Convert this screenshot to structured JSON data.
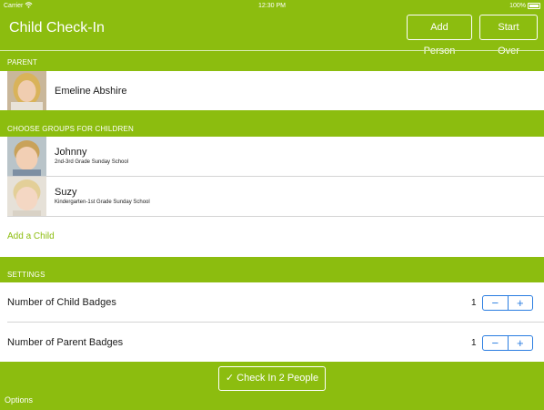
{
  "status_bar": {
    "carrier": "Carrier",
    "time": "12:30 PM",
    "battery": "100%"
  },
  "nav": {
    "title": "Child Check-In",
    "add_person_label": "Add Person",
    "start_over_label": "Start Over"
  },
  "parent_section": {
    "header": "PARENT",
    "name": "Emeline Abshire"
  },
  "children_section": {
    "header": "CHOOSE GROUPS FOR CHILDREN",
    "children": [
      {
        "name": "Johnny",
        "group": "2nd-3rd Grade Sunday School"
      },
      {
        "name": "Suzy",
        "group": "Kindergarten-1st Grade Sunday School"
      }
    ],
    "add_child_label": "Add a Child"
  },
  "settings_section": {
    "header": "SETTINGS",
    "rows": [
      {
        "label": "Number of Child Badges",
        "value": "1"
      },
      {
        "label": "Number of Parent Badges",
        "value": "1"
      }
    ],
    "minus_symbol": "−",
    "plus_symbol": "+"
  },
  "footer": {
    "check_in_label": "✓ Check In 2 People",
    "options_label": "Options"
  },
  "colors": {
    "brand_green": "#8cbd0f",
    "stepper_blue": "#2a7de1"
  }
}
